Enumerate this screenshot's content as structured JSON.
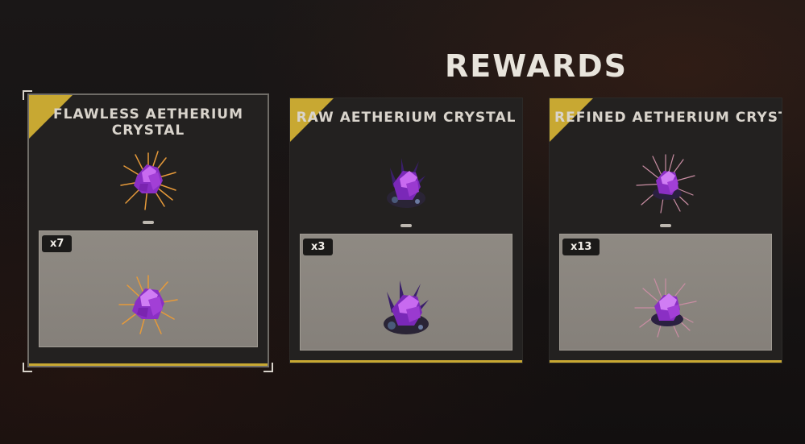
{
  "title": "REWARDS",
  "colors": {
    "accent": "#c8a832",
    "gem_primary": "#a23fd6",
    "gem_highlight": "#e07cf4",
    "spike_orange": "#e69a3a",
    "spike_pink": "#c98da3"
  },
  "rewards": [
    {
      "name": "FLAWLESS AETHERIUM CRYSTAL",
      "quantity": "x7",
      "icon": "flawless-aetherium-crystal-icon",
      "selected": true
    },
    {
      "name": "RAW AETHERIUM CRYSTAL",
      "quantity": "x3",
      "icon": "raw-aetherium-crystal-icon",
      "selected": false
    },
    {
      "name": "REFINED AETHERIUM CRYSTAL",
      "quantity": "x13",
      "icon": "refined-aetherium-crystal-icon",
      "selected": false
    }
  ]
}
